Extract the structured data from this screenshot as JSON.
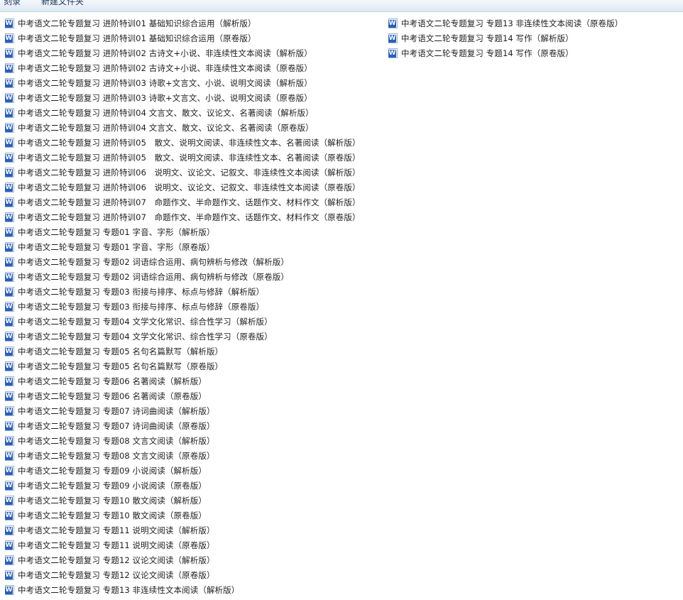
{
  "toolbar": {
    "burn_label": "刻录",
    "new_folder_label": "新建文件夹"
  },
  "files": [
    "中考语文二轮专题复习 进阶特训01 基础知识综合运用（解析版）",
    "中考语文二轮专题复习 进阶特训01 基础知识综合运用（原卷版）",
    "中考语文二轮专题复习 进阶特训02 古诗文+小说、非连续性文本阅读（解析版）",
    "中考语文二轮专题复习 进阶特训02 古诗文+小说、非连续性文本阅读（原卷版）",
    "中考语文二轮专题复习 进阶特训03 诗歌+文言文、小说、说明文阅读（解析版）",
    "中考语文二轮专题复习 进阶特训03 诗歌+文言文、小说、说明文阅读（原卷版）",
    "中考语文二轮专题复习 进阶特训04 文言文、散文、议论文、名著阅读（解析版）",
    "中考语文二轮专题复习 进阶特训04 文言文、散文、议论文、名著阅读（原卷版）",
    "中考语文二轮专题复习 进阶特训05　散文、说明文阅读、非连续性文本、名著阅读（解析版）",
    "中考语文二轮专题复习 进阶特训05　散文、说明文阅读、非连续性文本、名著阅读（原卷版）",
    "中考语文二轮专题复习 进阶特训06　说明文、议论文、记叙文、非连续性文本阅读（解析版）",
    "中考语文二轮专题复习 进阶特训06　说明文、议论文、记叙文、非连续性文本阅读（原卷版）",
    "中考语文二轮专题复习 进阶特训07　命题作文、半命题作文、话题作文、材料作文（解析版）",
    "中考语文二轮专题复习 进阶特训07　命题作文、半命题作文、话题作文、材料作文（原卷版）",
    "中考语文二轮专题复习 专题01 字音、字形（解析版）",
    "中考语文二轮专题复习 专题01 字音、字形（原卷版）",
    "中考语文二轮专题复习 专题02 词语综合运用、病句辨析与修改（解析版）",
    "中考语文二轮专题复习 专题02 词语综合运用、病句辨析与修改（原卷版）",
    "中考语文二轮专题复习 专题03 衔接与排序、标点与修辞（解析版）",
    "中考语文二轮专题复习 专题03 衔接与排序、标点与修辞（原卷版）",
    "中考语文二轮专题复习 专题04 文学文化常识、综合性学习（解析版）",
    "中考语文二轮专题复习 专题04 文学文化常识、综合性学习（原卷版）",
    "中考语文二轮专题复习 专题05 名句名篇默写（解析版）",
    "中考语文二轮专题复习 专题05 名句名篇默写（原卷版）",
    "中考语文二轮专题复习 专题06 名著阅读（解析版）",
    "中考语文二轮专题复习 专题06 名著阅读（原卷版）",
    "中考语文二轮专题复习 专题07 诗词曲阅读（解析版）",
    "中考语文二轮专题复习 专题07 诗词曲阅读（原卷版）",
    "中考语文二轮专题复习 专题08 文言文阅读（解析版）",
    "中考语文二轮专题复习 专题08 文言文阅读（原卷版）",
    "中考语文二轮专题复习 专题09 小说阅读（解析版）",
    "中考语文二轮专题复习 专题09 小说阅读（原卷版）",
    "中考语文二轮专题复习 专题10 散文阅读（解析版）",
    "中考语文二轮专题复习 专题10 散文阅读（原卷版）",
    "中考语文二轮专题复习 专题11 说明文阅读（解析版）",
    "中考语文二轮专题复习 专题11 说明文阅读（原卷版）",
    "中考语文二轮专题复习 专题12 议论文阅读（解析版）",
    "中考语文二轮专题复习 专题12 议论文阅读（原卷版）",
    "中考语文二轮专题复习 专题13 非连续性文本阅读（解析版）",
    "中考语文二轮专题复习 专题13 非连续性文本阅读（原卷版）",
    "中考语文二轮专题复习 专题14 写作（解析版）",
    "中考语文二轮专题复习 专题14 写作（原卷版）"
  ]
}
